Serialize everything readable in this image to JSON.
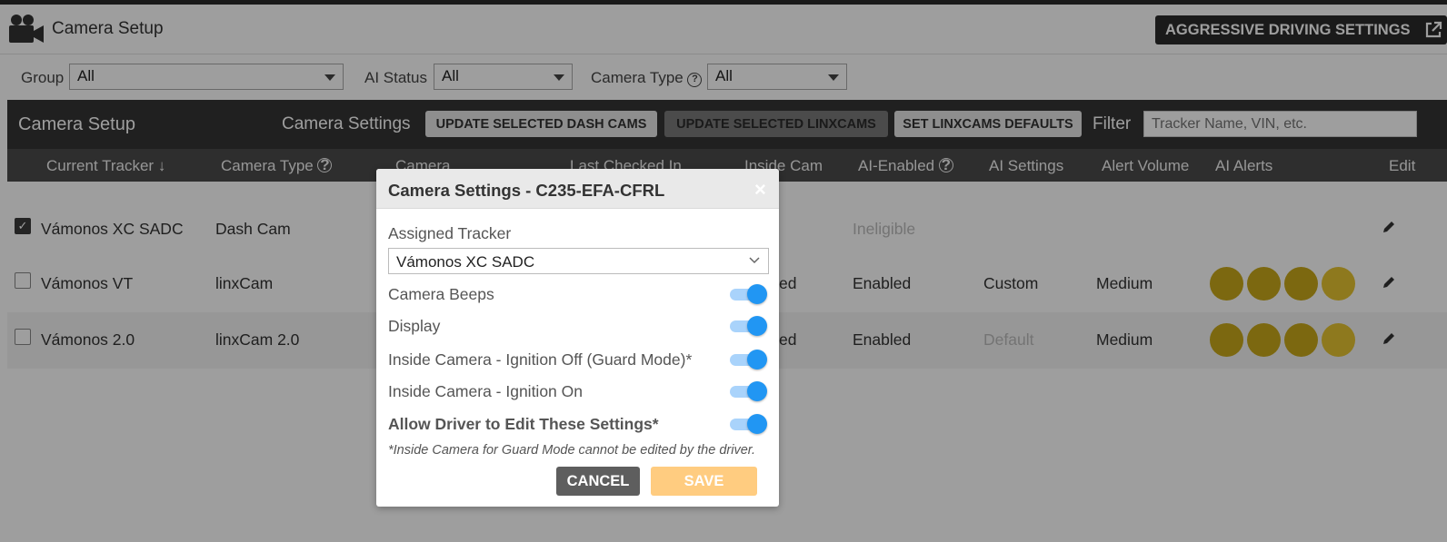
{
  "header": {
    "title": "Camera Setup",
    "aggressive_button": "AGGRESSIVE DRIVING SETTINGS"
  },
  "filters": {
    "group_label": "Group",
    "group_value": "All",
    "ai_status_label": "AI Status",
    "ai_status_value": "All",
    "camera_type_label": "Camera Type",
    "camera_type_value": "All"
  },
  "toolbar": {
    "title": "Camera Setup",
    "camera_settings_label": "Camera Settings",
    "update_dash_cams": "UPDATE SELECTED DASH CAMS",
    "update_linxcams": "UPDATE SELECTED LINXCAMS",
    "set_defaults": "SET LINXCAMS DEFAULTS",
    "filter_label": "Filter",
    "filter_placeholder": "Tracker Name, VIN, etc."
  },
  "columns": {
    "current_tracker": "Current Tracker",
    "camera_type": "Camera Type",
    "camera": "Camera",
    "last_checked_in": "Last Checked In",
    "inside_cam": "Inside Cam",
    "ai_enabled": "AI-Enabled",
    "ai_settings": "AI Settings",
    "alert_volume": "Alert Volume",
    "ai_alerts": "AI Alerts",
    "edit": "Edit"
  },
  "rows": [
    {
      "checked": true,
      "tracker": "Vámonos XC SADC",
      "camera_type": "Dash Cam",
      "inside_cam": "",
      "ai_enabled": "Ineligible",
      "ai_settings": "",
      "alert_volume": ""
    },
    {
      "checked": false,
      "tracker": "Vámonos VT",
      "camera_type": "linxCam",
      "inside_cam": "ed",
      "ai_enabled": "Enabled",
      "ai_settings": "Custom",
      "alert_volume": "Medium"
    },
    {
      "checked": false,
      "tracker": "Vámonos 2.0",
      "camera_type": "linxCam 2.0",
      "inside_cam": "ed",
      "ai_enabled": "Enabled",
      "ai_settings": "Default",
      "alert_volume": "Medium"
    }
  ],
  "alert_icons": [
    "steering-wheel-icon",
    "phone-distraction-icon",
    "seatbelt-icon",
    "vehicle-collision-icon"
  ],
  "modal": {
    "title": "Camera Settings - C235-EFA-CFRL",
    "close": "×",
    "assigned_tracker_label": "Assigned Tracker",
    "assigned_tracker_value": "Vámonos XC SADC",
    "settings": [
      {
        "label": "Camera Beeps",
        "on": true
      },
      {
        "label": "Display",
        "on": true
      },
      {
        "label": "Inside Camera - Ignition Off (Guard Mode)*",
        "on": true
      },
      {
        "label": "Inside Camera - Ignition On",
        "on": true
      },
      {
        "label": "Allow Driver to Edit These Settings*",
        "on": true
      }
    ],
    "note": "*Inside Camera for Guard Mode cannot be edited by the driver.",
    "cancel": "CANCEL",
    "save": "SAVE"
  },
  "colors": {
    "dark": "#343434",
    "toggle_blue": "#2196f3",
    "save_orange": "#ffcc80",
    "alert_gold": "#c9a81a"
  }
}
